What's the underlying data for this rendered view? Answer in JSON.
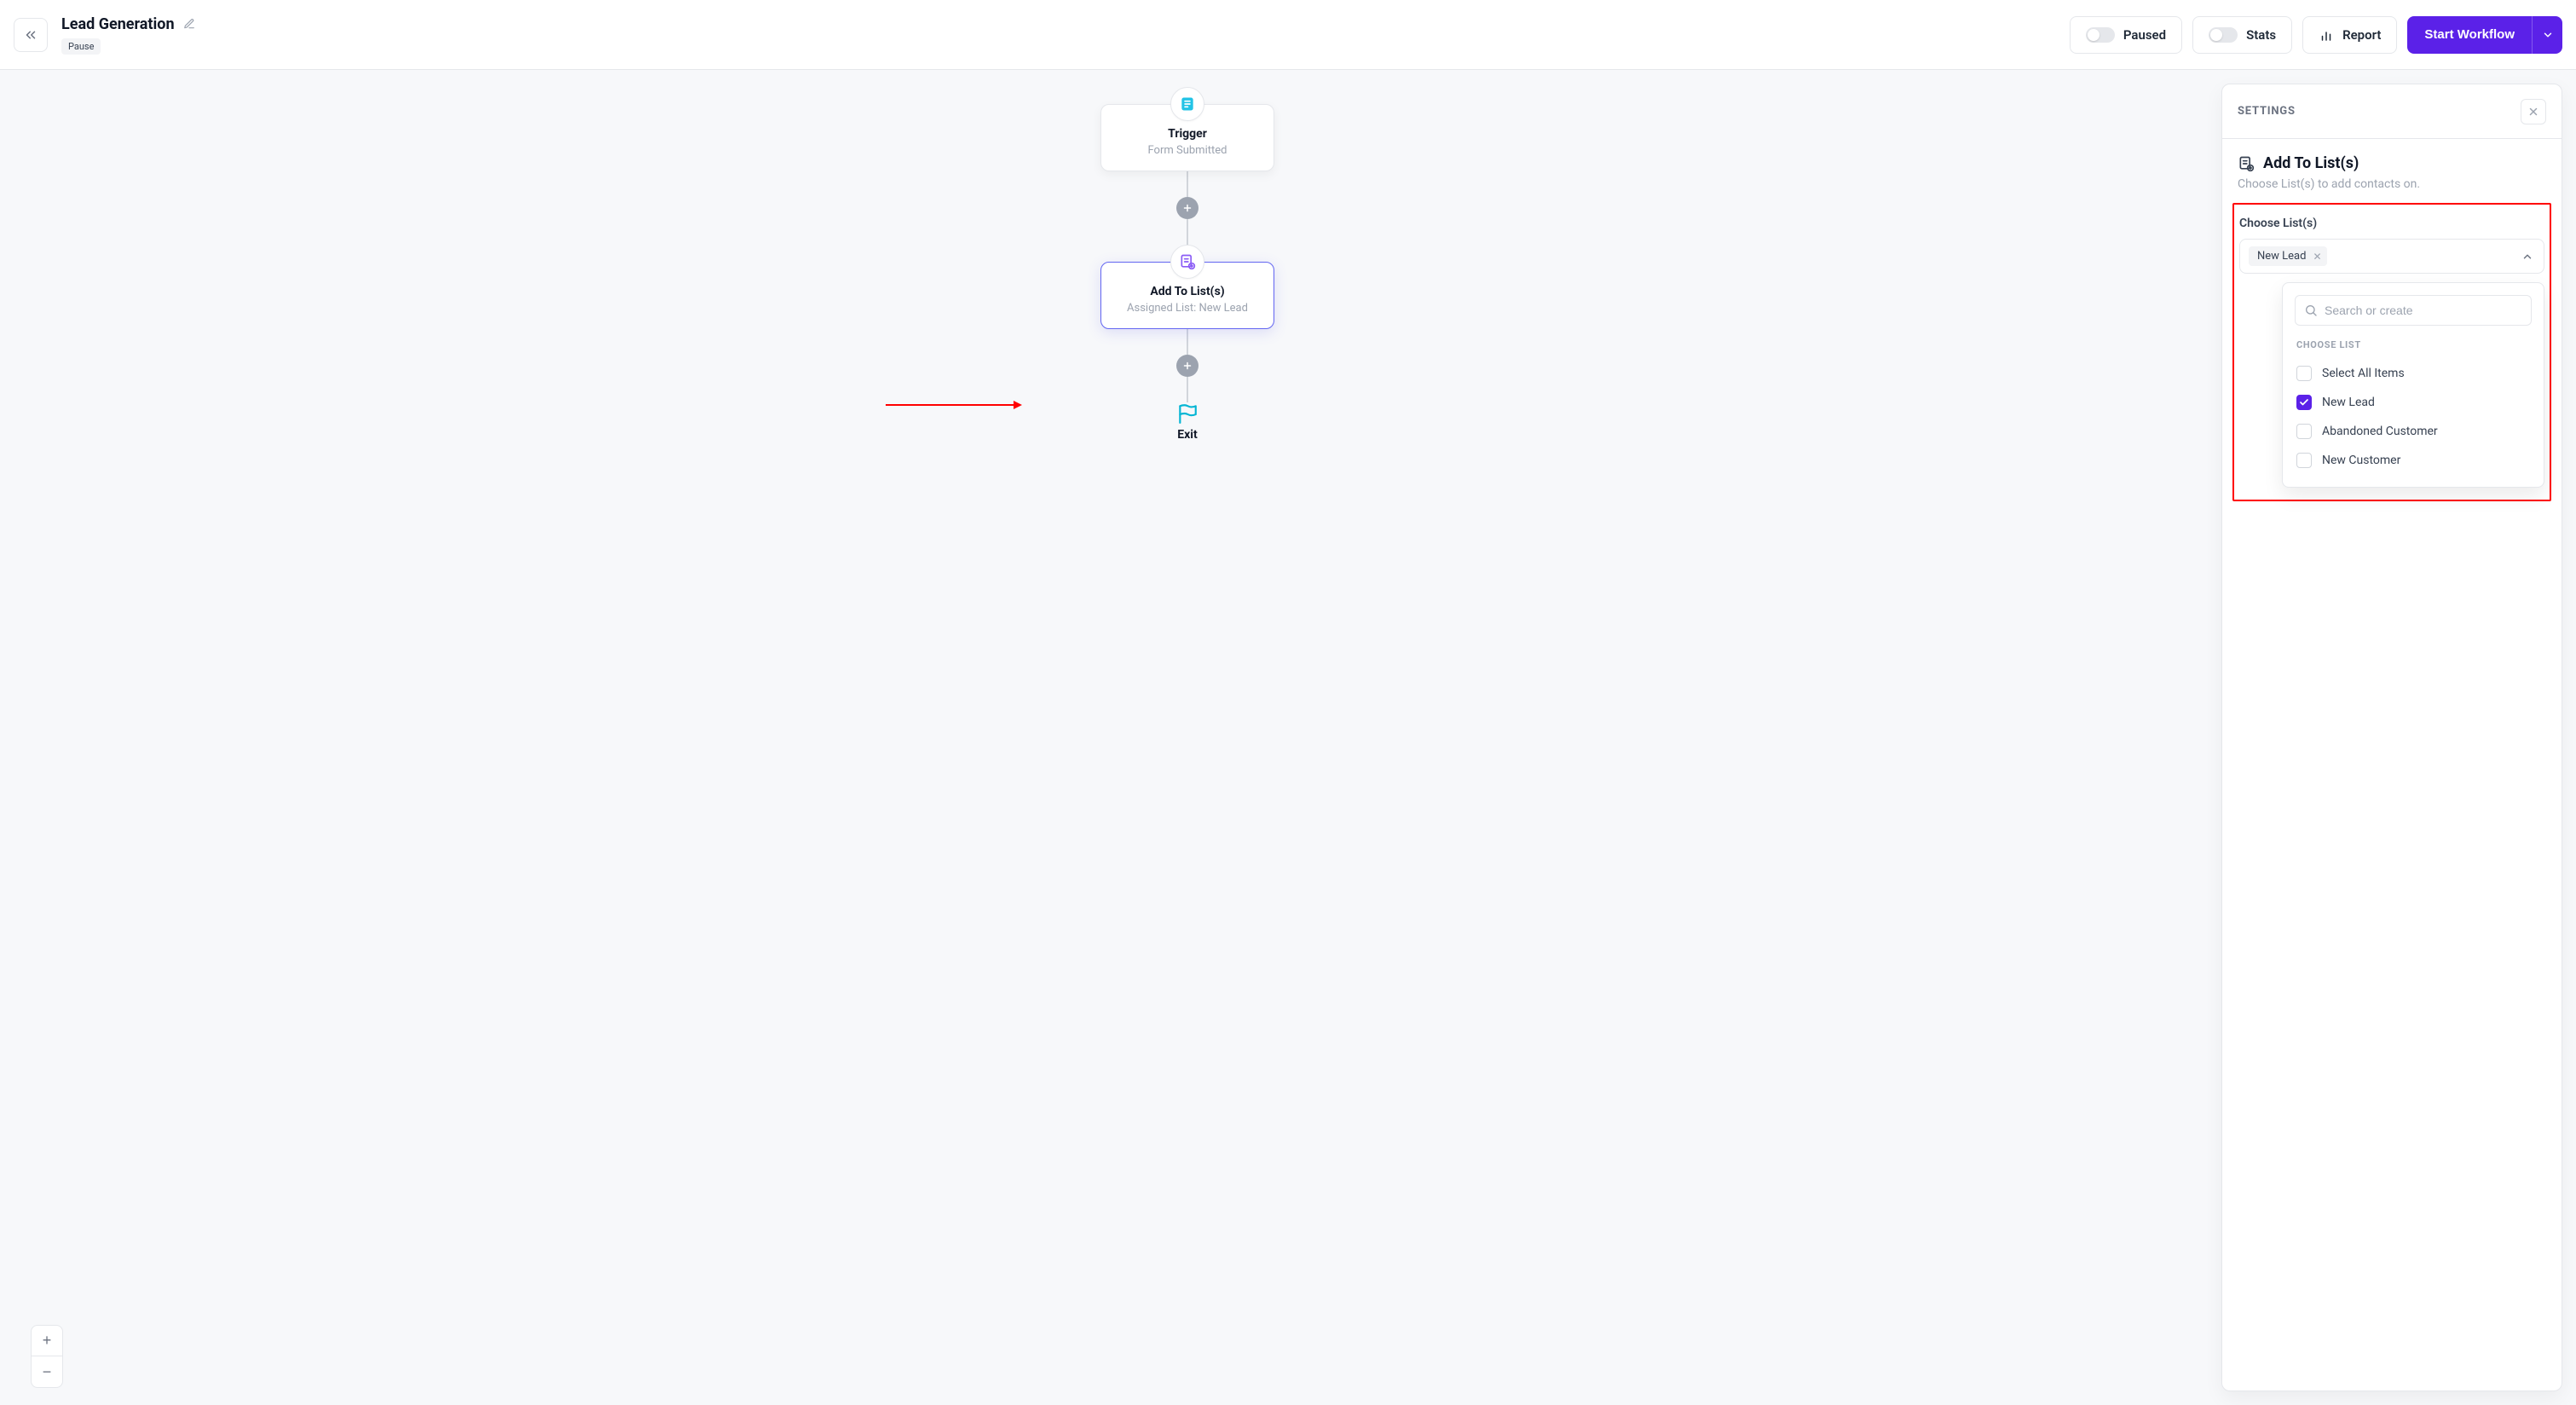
{
  "header": {
    "title": "Lead Generation",
    "status_chip": "Pause",
    "paused_toggle_label": "Paused",
    "stats_toggle_label": "Stats",
    "report_label": "Report",
    "start_label": "Start Workflow"
  },
  "flow": {
    "trigger": {
      "title": "Trigger",
      "subtitle": "Form Submitted"
    },
    "action": {
      "title": "Add To List(s)",
      "subtitle": "Assigned List: New Lead"
    },
    "exit_label": "Exit"
  },
  "panel": {
    "head": "SETTINGS",
    "title": "Add To List(s)",
    "desc": "Choose List(s) to add contacts on.",
    "field_label": "Choose List(s)",
    "selected_tags": [
      "New Lead"
    ],
    "search_placeholder": "Search or create",
    "dropdown_section_label": "CHOOSE LIST",
    "options": [
      {
        "label": "Select All Items",
        "checked": false
      },
      {
        "label": "New Lead",
        "checked": true
      },
      {
        "label": "Abandoned Customer",
        "checked": false
      },
      {
        "label": "New Customer",
        "checked": false
      }
    ]
  },
  "zoom": {
    "in": "+",
    "out": "−"
  }
}
